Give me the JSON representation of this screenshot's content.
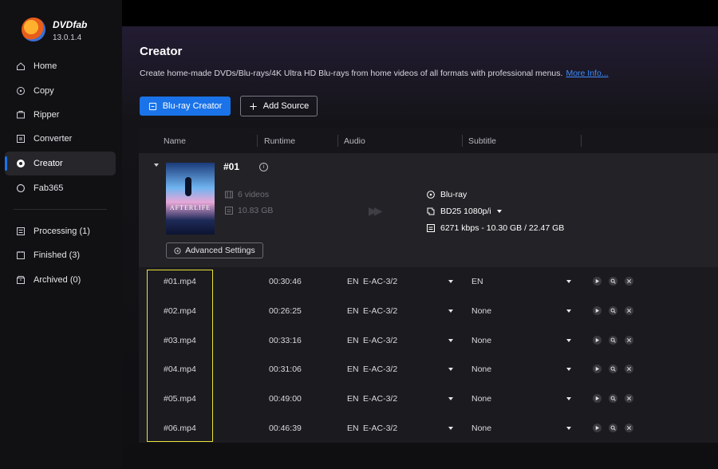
{
  "app": {
    "brand": "DVDfab",
    "version": "13.0.1.4"
  },
  "sidebar": {
    "items": [
      {
        "label": "Home",
        "icon": "home-icon"
      },
      {
        "label": "Copy",
        "icon": "copy-icon"
      },
      {
        "label": "Ripper",
        "icon": "ripper-icon"
      },
      {
        "label": "Converter",
        "icon": "converter-icon"
      },
      {
        "label": "Creator",
        "icon": "creator-icon",
        "active": true
      },
      {
        "label": "Fab365",
        "icon": "fab365-icon"
      }
    ],
    "queue": [
      {
        "label": "Processing (1)",
        "icon": "processing-icon"
      },
      {
        "label": "Finished (3)",
        "icon": "finished-icon"
      },
      {
        "label": "Archived (0)",
        "icon": "archived-icon"
      }
    ]
  },
  "main": {
    "title": "Creator",
    "description": "Create home-made DVDs/Blu-rays/4K Ultra HD Blu-rays from home videos of all formats with professional menus.",
    "more_info": "More Info...",
    "mode_button": "Blu-ray Creator",
    "add_source_button": "Add Source"
  },
  "table": {
    "headers": {
      "name": "Name",
      "runtime": "Runtime",
      "audio": "Audio",
      "subtitle": "Subtitle"
    }
  },
  "source": {
    "number": "#01",
    "poster_title": "AFTERLIFE",
    "videos": "6 videos",
    "size": "10.83 GB",
    "output_format": "Blu-ray",
    "output_disc": "BD25 1080p/i",
    "output_bitrate": "6271 kbps - 10.30 GB / 22.47 GB",
    "advanced_settings": "Advanced Settings"
  },
  "files": [
    {
      "name": "#01.mp4",
      "runtime": "00:30:46",
      "audio_lang": "EN",
      "audio_codec": "E-AC-3/2",
      "subtitle": "EN"
    },
    {
      "name": "#02.mp4",
      "runtime": "00:26:25",
      "audio_lang": "EN",
      "audio_codec": "E-AC-3/2",
      "subtitle": "None"
    },
    {
      "name": "#03.mp4",
      "runtime": "00:33:16",
      "audio_lang": "EN",
      "audio_codec": "E-AC-3/2",
      "subtitle": "None"
    },
    {
      "name": "#04.mp4",
      "runtime": "00:31:06",
      "audio_lang": "EN",
      "audio_codec": "E-AC-3/2",
      "subtitle": "None"
    },
    {
      "name": "#05.mp4",
      "runtime": "00:49:00",
      "audio_lang": "EN",
      "audio_codec": "E-AC-3/2",
      "subtitle": "None"
    },
    {
      "name": "#06.mp4",
      "runtime": "00:46:39",
      "audio_lang": "EN",
      "audio_codec": "E-AC-3/2",
      "subtitle": "None"
    }
  ],
  "colors": {
    "accent": "#1a73e8",
    "highlight": "#e8e33a",
    "link": "#3a8dff"
  }
}
